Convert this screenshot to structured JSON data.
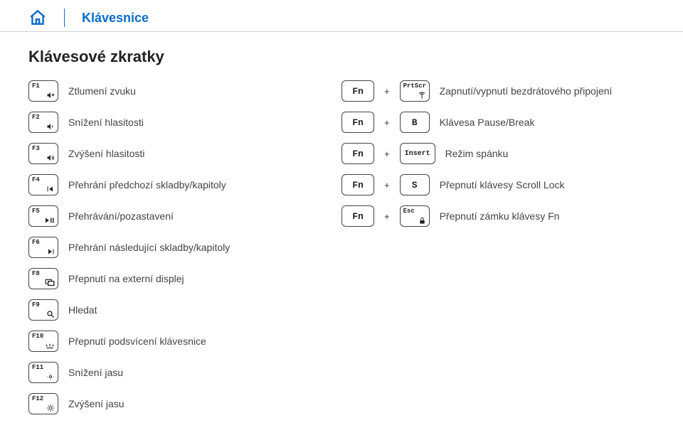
{
  "header": {
    "title": "Klávesnice"
  },
  "section_title": "Klávesové zkratky",
  "plus": "+",
  "fn": "Fn",
  "left": [
    {
      "key_top": "F1",
      "desc": "Ztlumení zvuku"
    },
    {
      "key_top": "F2",
      "desc": "Snížení hlasitosti"
    },
    {
      "key_top": "F3",
      "desc": "Zvýšení hlasitosti"
    },
    {
      "key_top": "F4",
      "desc": "Přehrání předchozí skladby/kapitoly"
    },
    {
      "key_top": "F5",
      "desc": "Přehrávání/pozastavení"
    },
    {
      "key_top": "F6",
      "desc": "Přehrání následující skladby/kapitoly"
    },
    {
      "key_top": "F8",
      "desc": "Přepnutí na externí displej"
    },
    {
      "key_top": "F9",
      "desc": "Hledat"
    },
    {
      "key_top": "F10",
      "desc": "Přepnutí podsvícení klávesnice"
    },
    {
      "key_top": "F11",
      "desc": "Snížení jasu"
    },
    {
      "key_top": "F12",
      "desc": "Zvýšení jasu"
    }
  ],
  "right": [
    {
      "key2_top": "PrtScr",
      "key2_center": "",
      "desc": "Zapnutí/vypnutí bezdrátového připojení"
    },
    {
      "key2_top": "",
      "key2_center": "B",
      "desc": "Klávesa Pause/Break"
    },
    {
      "key2_top": "",
      "key2_center": "Insert",
      "desc": "Režim spánku"
    },
    {
      "key2_top": "",
      "key2_center": "S",
      "desc": "Přepnutí klávesy Scroll Lock"
    },
    {
      "key2_top": "Esc",
      "key2_center": "",
      "desc": "Přepnutí zámku klávesy Fn"
    }
  ]
}
